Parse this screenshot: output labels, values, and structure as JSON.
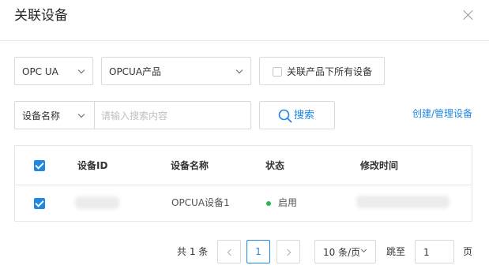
{
  "dialog": {
    "title": "关联设备"
  },
  "filters": {
    "protocol": "OPC UA",
    "product": "OPCUA产品",
    "all_devices_checkbox_label": "关联产品下所有设备",
    "all_devices_checked": false,
    "search_field": "设备名称",
    "search_placeholder": "请输入搜索内容",
    "search_button": "搜索",
    "manage_link": "创建/管理设备"
  },
  "table": {
    "columns": [
      "设备ID",
      "设备名称",
      "状态",
      "修改时间"
    ],
    "header_checked": true,
    "rows": [
      {
        "checked": true,
        "device_id_redacted": true,
        "device_name": "OPCUA设备1",
        "status": "启用",
        "status_color": "#2eb84b",
        "modified_time_redacted": true
      }
    ]
  },
  "pagination": {
    "total_text": "共 1 条",
    "current_page": "1",
    "page_size": "10 条/页",
    "jump_label": "跳至",
    "jump_value": "1",
    "page_suffix": "页"
  },
  "colors": {
    "accent": "#1e88e5",
    "border": "#d9d9d9"
  }
}
